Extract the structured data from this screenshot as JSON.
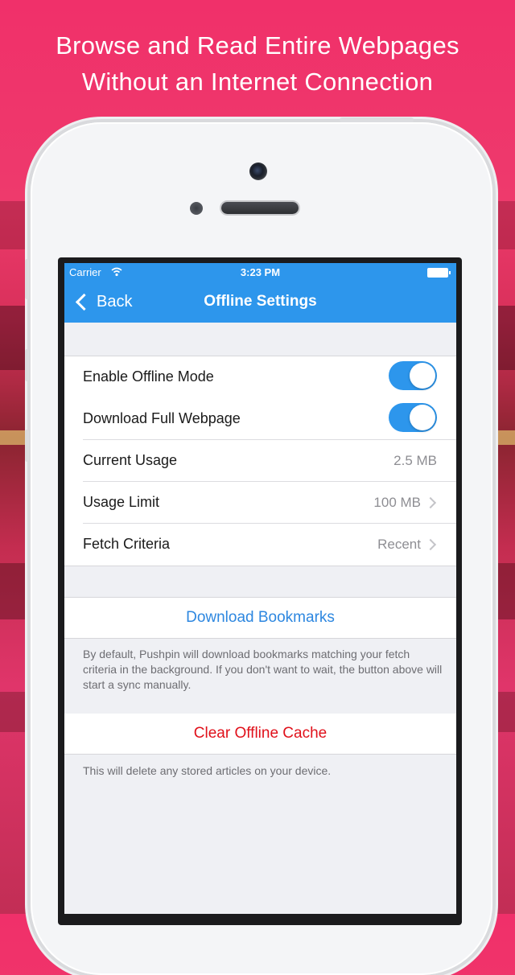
{
  "headline": {
    "line1": "Browse and Read Entire Webpages",
    "line2": "Without an Internet Connection"
  },
  "status_bar": {
    "carrier": "Carrier",
    "time": "3:23 PM"
  },
  "nav": {
    "back_label": "Back",
    "title": "Offline Settings",
    "color": "#2d96ec"
  },
  "settings": [
    {
      "label": "Enable Offline Mode",
      "type": "toggle",
      "on": true
    },
    {
      "label": "Download Full Webpage",
      "type": "toggle",
      "on": true
    },
    {
      "label": "Current Usage",
      "type": "value",
      "value": "2.5 MB"
    },
    {
      "label": "Usage Limit",
      "type": "disclosure",
      "value": "100 MB"
    },
    {
      "label": "Fetch Criteria",
      "type": "disclosure",
      "value": "Recent"
    }
  ],
  "download": {
    "label": "Download Bookmarks",
    "note": "By default, Pushpin will download bookmarks matching your fetch criteria in the background. If you don't want to wait, the button above will start a sync manually.",
    "color": "#2d87e0"
  },
  "clear": {
    "label": "Clear Offline Cache",
    "note": "This will delete any stored articles on your device.",
    "color": "#e0111b"
  }
}
